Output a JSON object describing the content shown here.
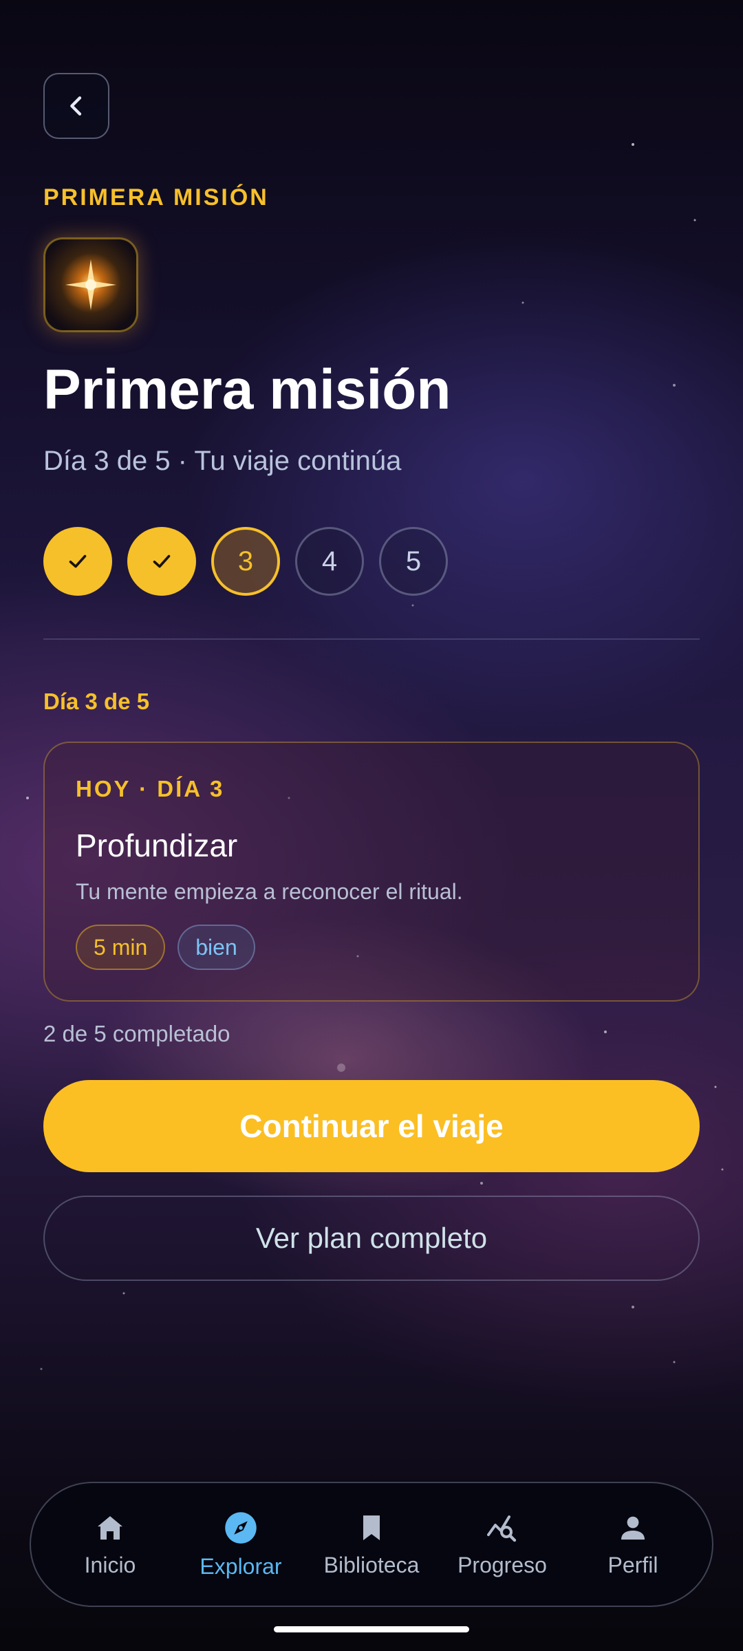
{
  "header": {
    "eyebrow": "PRIMERA MISIÓN",
    "title": "Primera misión",
    "subtitle": "Día 3 de 5 · Tu viaje continúa"
  },
  "steps": [
    {
      "state": "done",
      "label": ""
    },
    {
      "state": "done",
      "label": ""
    },
    {
      "state": "current",
      "label": "3"
    },
    {
      "state": "pending",
      "label": "4"
    },
    {
      "state": "pending",
      "label": "5"
    }
  ],
  "section_label": "Día 3 de 5",
  "card": {
    "tag": "HOY · DÍA 3",
    "title": "Profundizar",
    "description": "Tu mente empieza a reconocer el ritual.",
    "duration": "5 min",
    "level": "bien"
  },
  "progress_text": "2 de 5 completado",
  "buttons": {
    "primary": "Continuar el viaje",
    "secondary": "Ver plan completo"
  },
  "nav": {
    "items": [
      {
        "label": "Inicio",
        "icon": "home-icon"
      },
      {
        "label": "Explorar",
        "icon": "compass-icon",
        "active": true
      },
      {
        "label": "Biblioteca",
        "icon": "bookmark-icon"
      },
      {
        "label": "Progreso",
        "icon": "progress-search-icon"
      },
      {
        "label": "Perfil",
        "icon": "person-icon"
      }
    ]
  },
  "colors": {
    "accent": "#f6c02a",
    "primary_button": "#fbbf24",
    "active_nav": "#5bb8f2"
  }
}
